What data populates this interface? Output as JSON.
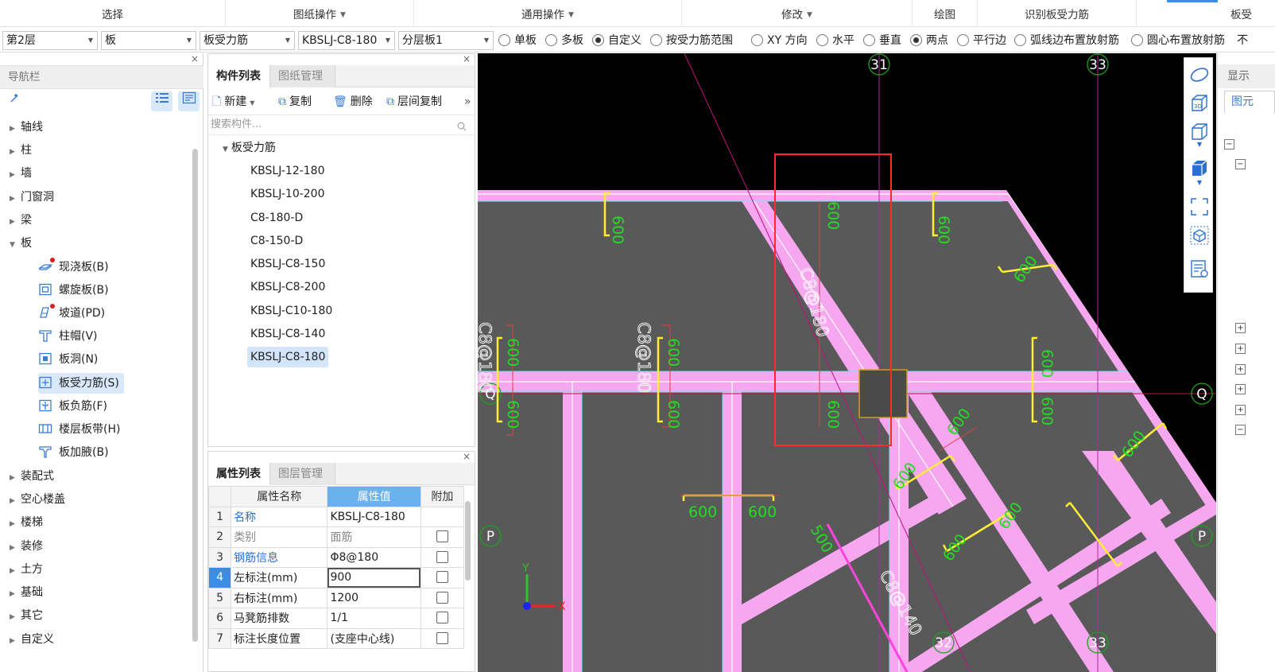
{
  "ribbon": {
    "groups": [
      {
        "label": "选择",
        "dropdown": false
      },
      {
        "label": "图纸操作",
        "dropdown": true
      },
      {
        "label": "通用操作",
        "dropdown": true
      },
      {
        "label": "修改",
        "dropdown": true
      },
      {
        "label": "绘图",
        "dropdown": false
      },
      {
        "label": "识别板受力筋",
        "dropdown": false
      },
      {
        "label": "板受",
        "dropdown": false
      }
    ]
  },
  "toolbar": {
    "floor": "第2层",
    "category": "板",
    "component_type": "板受力筋",
    "component_name": "KBSLJ-C8-180",
    "layer_slab": "分层板1",
    "options": [
      {
        "label": "单板",
        "checked": false
      },
      {
        "label": "多板",
        "checked": false
      },
      {
        "label": "自定义",
        "checked": true
      },
      {
        "label": "按受力筋范围",
        "checked": false
      },
      {
        "label": "XY 方向",
        "checked": false
      },
      {
        "label": "水平",
        "checked": false
      },
      {
        "label": "垂直",
        "checked": false
      },
      {
        "label": "两点",
        "checked": true
      },
      {
        "label": "平行边",
        "checked": false
      },
      {
        "label": "弧线边布置放射筋",
        "checked": false
      },
      {
        "label": "圆心布置放射筋",
        "checked": false
      },
      {
        "label": "不",
        "checked": false
      }
    ]
  },
  "navigator": {
    "title": "导航栏",
    "close": "×",
    "items": [
      {
        "label": "轴线",
        "expanded": false
      },
      {
        "label": "柱",
        "expanded": false
      },
      {
        "label": "墙",
        "expanded": false
      },
      {
        "label": "门窗洞",
        "expanded": false
      },
      {
        "label": "梁",
        "expanded": false
      },
      {
        "label": "板",
        "expanded": true
      },
      {
        "label": "装配式",
        "expanded": false
      },
      {
        "label": "空心楼盖",
        "expanded": false
      },
      {
        "label": "楼梯",
        "expanded": false
      },
      {
        "label": "装修",
        "expanded": false
      },
      {
        "label": "土方",
        "expanded": false
      },
      {
        "label": "基础",
        "expanded": false
      },
      {
        "label": "其它",
        "expanded": false
      },
      {
        "label": "自定义",
        "expanded": false
      }
    ],
    "slab_children": [
      {
        "label": "现浇板(B)",
        "icon": "cast-slab-icon",
        "flag": true
      },
      {
        "label": "螺旋板(B)",
        "icon": "spiral-slab-icon",
        "flag": false
      },
      {
        "label": "坡道(PD)",
        "icon": "ramp-icon",
        "flag": true
      },
      {
        "label": "柱帽(V)",
        "icon": "column-cap-icon",
        "flag": false
      },
      {
        "label": "板洞(N)",
        "icon": "slab-hole-icon",
        "flag": false
      },
      {
        "label": "板受力筋(S)",
        "icon": "slab-rebar-icon",
        "flag": false,
        "selected": true
      },
      {
        "label": "板负筋(F)",
        "icon": "negative-rebar-icon",
        "flag": false
      },
      {
        "label": "楼层板带(H)",
        "icon": "floor-strip-icon",
        "flag": false
      },
      {
        "label": "板加腋(B)",
        "icon": "slab-haunch-icon",
        "flag": false
      }
    ]
  },
  "component_list": {
    "tabs": [
      "构件列表",
      "图纸管理"
    ],
    "close": "×",
    "actions": {
      "new": "新建",
      "copy": "复制",
      "delete": "删除",
      "floor_copy": "层间复制",
      "more": "»"
    },
    "search_placeholder": "搜索构件...",
    "group": "板受力筋",
    "items": [
      "KBSLJ-12-180",
      "KBSLJ-10-200",
      "C8-180-D",
      "C8-150-D",
      "KBSLJ-C8-150",
      "KBSLJ-C8-200",
      "KBSLJ-C10-180",
      "KBSLJ-C8-140",
      "KBSLJ-C8-180"
    ],
    "selected_index": 8
  },
  "properties": {
    "tabs": [
      "属性列表",
      "图层管理"
    ],
    "close": "×",
    "headers": [
      "属性名称",
      "属性值",
      "附加"
    ],
    "rows": [
      {
        "n": "1",
        "name": "名称",
        "value": "KBSLJ-C8-180",
        "blue": true,
        "gray": false,
        "attach": false
      },
      {
        "n": "2",
        "name": "类别",
        "value": "面筋",
        "blue": false,
        "gray": true,
        "attach": true
      },
      {
        "n": "3",
        "name": "钢筋信息",
        "value": "Φ8@180",
        "blue": true,
        "gray": false,
        "attach": true
      },
      {
        "n": "4",
        "name": "左标注(mm)",
        "value": "900",
        "blue": false,
        "gray": false,
        "attach": true,
        "current": true
      },
      {
        "n": "5",
        "name": "右标注(mm)",
        "value": "1200",
        "blue": false,
        "gray": false,
        "attach": true
      },
      {
        "n": "6",
        "name": "马凳筋排数",
        "value": "1/1",
        "blue": false,
        "gray": false,
        "attach": true
      },
      {
        "n": "7",
        "name": "标注长度位置",
        "value": "(支座中心线)",
        "blue": false,
        "gray": false,
        "attach": true
      }
    ]
  },
  "canvas": {
    "axis_labels": {
      "top_left": "31",
      "top_right": "33",
      "left_q": "Q",
      "right_q": "Q",
      "left_p": "P",
      "right_p": "P",
      "bottom_mid": "32",
      "bottom_right": "33"
    },
    "rebar_labels": [
      "C8@180",
      "C8@180",
      "C8@180",
      "C8@140"
    ],
    "dim_labels": [
      "600",
      "600",
      "600",
      "600",
      "600",
      "600",
      "600",
      "600",
      "600",
      "600",
      "600",
      "600",
      "600",
      "600",
      "600",
      "600",
      "600",
      "600",
      "500"
    ],
    "axes": {
      "x": "X",
      "y": "Y"
    }
  },
  "display_panel": {
    "title": "显示",
    "tab": "图元"
  },
  "colors": {
    "slab_fill": "#595959",
    "beam_pink": "#f7a6f0",
    "rebar_yellow": "#ffee33",
    "label_green": "#22dd22",
    "select_red": "#ff2a2a",
    "axis_red": "#d01030"
  }
}
